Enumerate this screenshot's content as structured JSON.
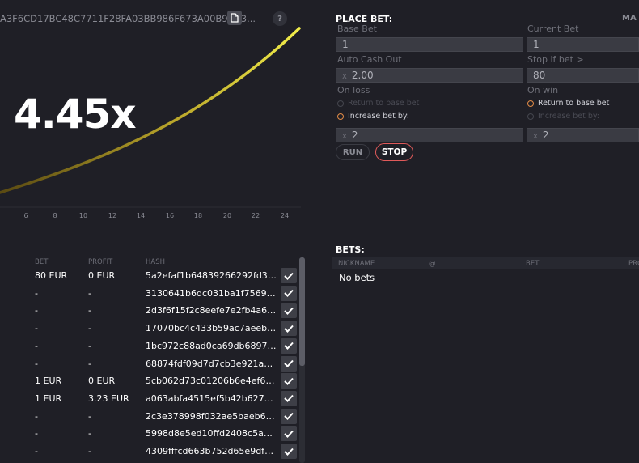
{
  "game": {
    "hash": "A3F6CD17BC48C7711F28FA03BB986F673A00B94D3...",
    "help_label": "?",
    "multiplier": "4.45x",
    "x_ticks": [
      "6",
      "8",
      "10",
      "12",
      "14",
      "16",
      "18",
      "20",
      "22",
      "24"
    ]
  },
  "history": {
    "headers": {
      "bet": "BET",
      "profit": "PROFIT",
      "hash": "HASH"
    },
    "rows": [
      {
        "bet": "80 EUR",
        "profit": "0 EUR",
        "hash": "5a2efaf1b64839266292fd35..."
      },
      {
        "bet": "-",
        "profit": "-",
        "hash": "3130641b6dc031ba1f7569b..."
      },
      {
        "bet": "-",
        "profit": "-",
        "hash": "2d3f6f15f2c8eefe7e2fb4a6f4..."
      },
      {
        "bet": "-",
        "profit": "-",
        "hash": "17070bc4c433b59ac7aeebfd..."
      },
      {
        "bet": "-",
        "profit": "-",
        "hash": "1bc972c88ad0ca69db68971f..."
      },
      {
        "bet": "-",
        "profit": "-",
        "hash": "68874fdf09d7d7cb3e921a65..."
      },
      {
        "bet": "1 EUR",
        "profit": "0 EUR",
        "hash": "5cb062d73c01206b6e4ef60b..."
      },
      {
        "bet": "1 EUR",
        "profit": "3.23 EUR",
        "hash": "a063abfa4515ef5b42b62761..."
      },
      {
        "bet": "-",
        "profit": "-",
        "hash": "2c3e378998f032ae5baeb692..."
      },
      {
        "bet": "-",
        "profit": "-",
        "hash": "5998d8e5ed10ffd2408c5ac8..."
      },
      {
        "bet": "-",
        "profit": "-",
        "hash": "4309fffcd663b752d65e9df2c..."
      }
    ]
  },
  "place_bet": {
    "title": "PLACE BET:",
    "mode_tab": "MA",
    "base_bet_label": "Base Bet",
    "base_bet_value": "1",
    "current_bet_label": "Current Bet",
    "current_bet_value": "1",
    "auto_cash_out_label": "Auto Cash Out",
    "auto_cash_out_prefix": "x",
    "auto_cash_out_value": "2.00",
    "stop_if_label": "Stop if bet >",
    "stop_if_value": "80",
    "on_loss_label": "On loss",
    "on_loss_return": "Return to base bet",
    "on_loss_increase": "Increase bet by:",
    "on_loss_prefix": "x",
    "on_loss_value": "2",
    "on_win_label": "On win",
    "on_win_return": "Return to base bet",
    "on_win_increase": "Increase bet by:",
    "on_win_prefix": "x",
    "on_win_value": "2",
    "run_label": "RUN",
    "stop_label": "STOP"
  },
  "bets": {
    "title": "BETS:",
    "headers": {
      "nickname": "NICKNAME",
      "at": "@",
      "bet": "BET",
      "profit": "PRO"
    },
    "empty_text": "No bets"
  },
  "colors": {
    "background": "#1f1f26",
    "curve_start": "#5a4a12",
    "curve_end": "#f2ee4a",
    "accent_orange": "#e08a46",
    "stop_red": "#e05a5a"
  }
}
